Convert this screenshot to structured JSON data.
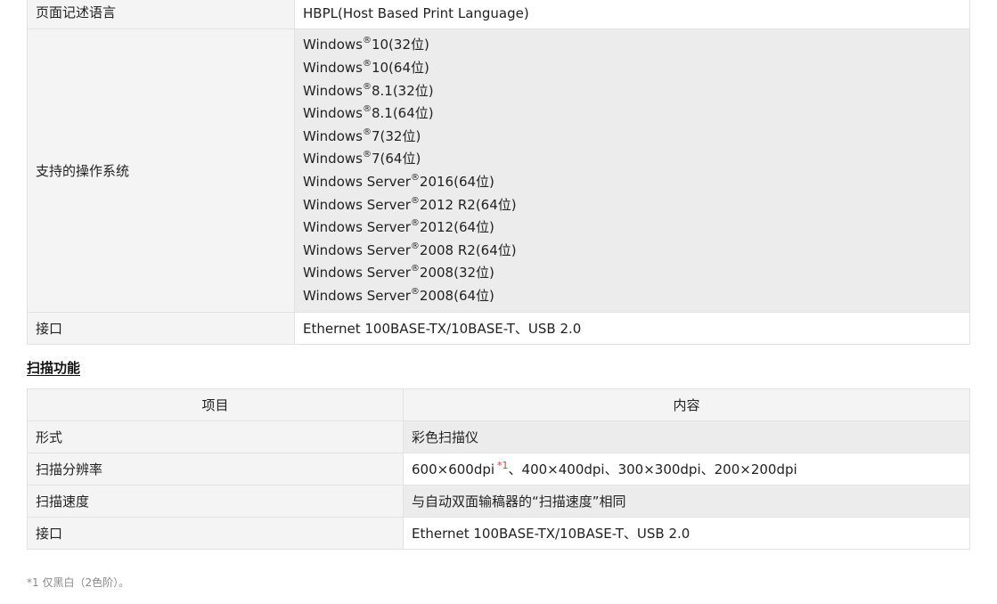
{
  "printer_table": {
    "rows": [
      {
        "label": "页面记述语言",
        "value": "HBPL(Host Based Print Language)"
      },
      {
        "label": "支持的操作系统"
      },
      {
        "label": "接口",
        "value": "Ethernet 100BASE-TX/10BASE-T、USB 2.0"
      }
    ],
    "os_list": [
      {
        "name": "Windows",
        "mark": "®",
        "version": "10(32位)"
      },
      {
        "name": "Windows",
        "mark": "®",
        "version": "10(64位)"
      },
      {
        "name": "Windows",
        "mark": "®",
        "version": "8.1(32位)"
      },
      {
        "name": "Windows",
        "mark": "®",
        "version": "8.1(64位)"
      },
      {
        "name": "Windows",
        "mark": "®",
        "version": "7(32位)"
      },
      {
        "name": "Windows",
        "mark": "®",
        "version": "7(64位)"
      },
      {
        "name": "Windows Server",
        "mark": "®",
        "version": "2016(64位)"
      },
      {
        "name": "Windows Server",
        "mark": "®",
        "version": "2012 R2(64位)"
      },
      {
        "name": "Windows Server",
        "mark": "®",
        "version": "2012(64位)"
      },
      {
        "name": "Windows Server",
        "mark": "®",
        "version": "2008 R2(64位)"
      },
      {
        "name": "Windows Server",
        "mark": "®",
        "version": "2008(32位)"
      },
      {
        "name": "Windows Server",
        "mark": "®",
        "version": "2008(64位)"
      }
    ]
  },
  "scan_section": {
    "title": "扫描功能",
    "headers": {
      "item": "项目",
      "content": "内容"
    },
    "rows": [
      {
        "label": "形式",
        "value": "彩色扫描仪"
      },
      {
        "label": "扫描分辨率",
        "value_main": "600×600dpi",
        "note_ref": "*1",
        "value_rest": "、400×400dpi、300×300dpi、200×200dpi"
      },
      {
        "label": "扫描速度",
        "value": "与自动双面输稿器的“扫描速度”相同"
      },
      {
        "label": "接口",
        "value": "Ethernet 100BASE-TX/10BASE-T、USB 2.0"
      }
    ]
  },
  "footnote": "*1 仅黑白（2色阶）。"
}
